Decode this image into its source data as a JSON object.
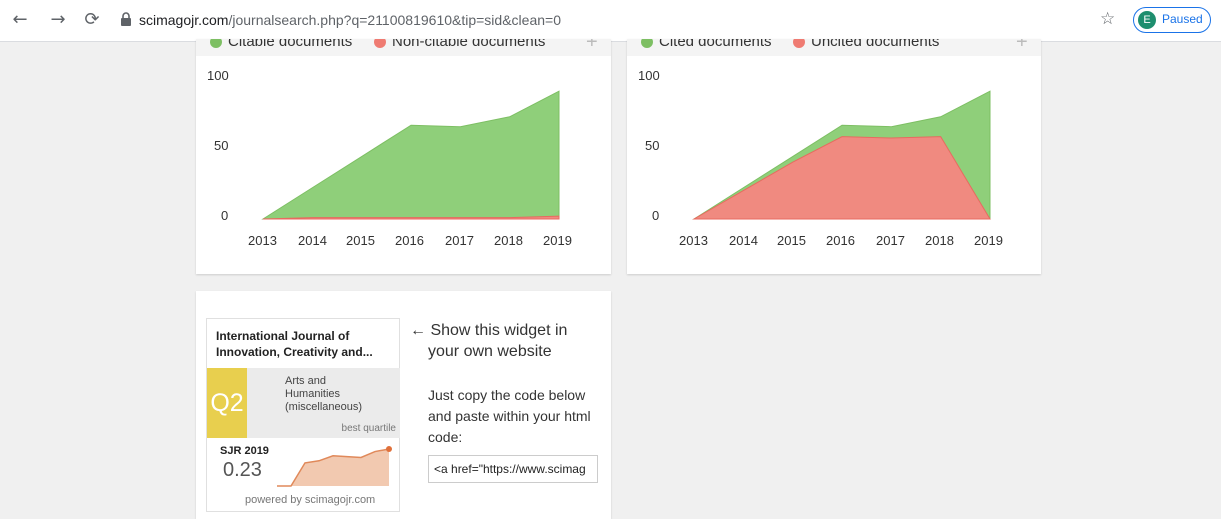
{
  "browser": {
    "url_host": "scimagojr.com",
    "url_path": "/journalsearch.php?q=21100819610&tip=sid&clean=0",
    "profile_initial": "E",
    "profile_status": "Paused",
    "icons": [
      "back-arrow-icon",
      "forward-arrow-icon",
      "reload-icon",
      "lock-icon",
      "star-icon"
    ]
  },
  "chart_left": {
    "legend": [
      "Citable documents",
      "Non-citable documents"
    ],
    "y_ticks": [
      "100",
      "50",
      "0"
    ],
    "x_ticks": [
      "2013",
      "2014",
      "2015",
      "2016",
      "2017",
      "2018",
      "2019"
    ]
  },
  "chart_right": {
    "legend": [
      "Cited documents",
      "Uncited documents"
    ],
    "y_ticks": [
      "100",
      "50",
      "0"
    ],
    "x_ticks": [
      "2013",
      "2014",
      "2015",
      "2016",
      "2017",
      "2018",
      "2019"
    ]
  },
  "chart_data": [
    {
      "type": "area",
      "x": [
        2013,
        2014,
        2015,
        2016,
        2017,
        2018,
        2019
      ],
      "ylim": [
        0,
        100
      ],
      "series": [
        {
          "name": "Citable documents",
          "color": "#8fcf7a",
          "values": [
            0,
            22,
            44,
            66,
            65,
            72,
            90
          ]
        },
        {
          "name": "Non-citable documents",
          "color": "#f08a80",
          "values": [
            0,
            1,
            1,
            1,
            1,
            1,
            2
          ]
        }
      ]
    },
    {
      "type": "area",
      "x": [
        2013,
        2014,
        2015,
        2016,
        2017,
        2018,
        2019
      ],
      "ylim": [
        0,
        100
      ],
      "series": [
        {
          "name": "Cited documents",
          "color": "#8fcf7a",
          "values": [
            0,
            22,
            44,
            66,
            65,
            72,
            90
          ]
        },
        {
          "name": "Uncited documents",
          "color": "#f08a80",
          "values": [
            0,
            20,
            40,
            58,
            57,
            58,
            0
          ]
        }
      ]
    }
  ],
  "widget": {
    "title": "International Journal of Innovation, Creativity and...",
    "quartile": "Q2",
    "category_line1": "Arts and",
    "category_line2": "Humanities",
    "category_line3": "(miscellaneous)",
    "best_quartile": "best quartile",
    "sjr_label": "SJR 2019",
    "sjr_value": "0.23",
    "powered_by": "powered by scimagojr.com",
    "sparkline": [
      0,
      0,
      0.55,
      0.6,
      0.72,
      0.7,
      0.68,
      0.82,
      0.88
    ],
    "arrow_line1": "← Show this widget in",
    "arrow_line2": "your own website",
    "copy_line1": "Just copy the code below",
    "copy_line2": "and paste within your html",
    "copy_line3": "code:",
    "code_value": "<a href=\"https://www.scimag"
  }
}
